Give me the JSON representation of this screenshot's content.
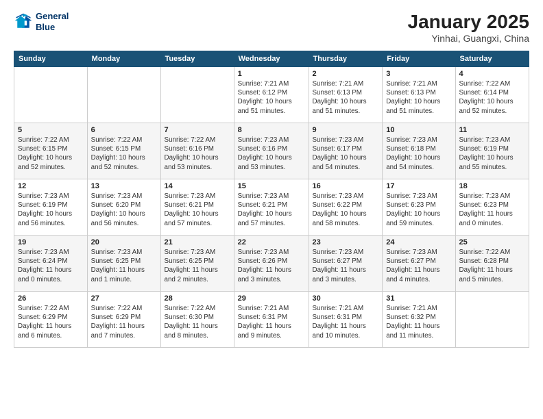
{
  "logo": {
    "line1": "General",
    "line2": "Blue"
  },
  "title": "January 2025",
  "subtitle": "Yinhai, Guangxi, China",
  "days_of_week": [
    "Sunday",
    "Monday",
    "Tuesday",
    "Wednesday",
    "Thursday",
    "Friday",
    "Saturday"
  ],
  "weeks": [
    [
      {
        "day": "",
        "info": ""
      },
      {
        "day": "",
        "info": ""
      },
      {
        "day": "",
        "info": ""
      },
      {
        "day": "1",
        "info": "Sunrise: 7:21 AM\nSunset: 6:12 PM\nDaylight: 10 hours\nand 51 minutes."
      },
      {
        "day": "2",
        "info": "Sunrise: 7:21 AM\nSunset: 6:13 PM\nDaylight: 10 hours\nand 51 minutes."
      },
      {
        "day": "3",
        "info": "Sunrise: 7:21 AM\nSunset: 6:13 PM\nDaylight: 10 hours\nand 51 minutes."
      },
      {
        "day": "4",
        "info": "Sunrise: 7:22 AM\nSunset: 6:14 PM\nDaylight: 10 hours\nand 52 minutes."
      }
    ],
    [
      {
        "day": "5",
        "info": "Sunrise: 7:22 AM\nSunset: 6:15 PM\nDaylight: 10 hours\nand 52 minutes."
      },
      {
        "day": "6",
        "info": "Sunrise: 7:22 AM\nSunset: 6:15 PM\nDaylight: 10 hours\nand 52 minutes."
      },
      {
        "day": "7",
        "info": "Sunrise: 7:22 AM\nSunset: 6:16 PM\nDaylight: 10 hours\nand 53 minutes."
      },
      {
        "day": "8",
        "info": "Sunrise: 7:23 AM\nSunset: 6:16 PM\nDaylight: 10 hours\nand 53 minutes."
      },
      {
        "day": "9",
        "info": "Sunrise: 7:23 AM\nSunset: 6:17 PM\nDaylight: 10 hours\nand 54 minutes."
      },
      {
        "day": "10",
        "info": "Sunrise: 7:23 AM\nSunset: 6:18 PM\nDaylight: 10 hours\nand 54 minutes."
      },
      {
        "day": "11",
        "info": "Sunrise: 7:23 AM\nSunset: 6:19 PM\nDaylight: 10 hours\nand 55 minutes."
      }
    ],
    [
      {
        "day": "12",
        "info": "Sunrise: 7:23 AM\nSunset: 6:19 PM\nDaylight: 10 hours\nand 56 minutes."
      },
      {
        "day": "13",
        "info": "Sunrise: 7:23 AM\nSunset: 6:20 PM\nDaylight: 10 hours\nand 56 minutes."
      },
      {
        "day": "14",
        "info": "Sunrise: 7:23 AM\nSunset: 6:21 PM\nDaylight: 10 hours\nand 57 minutes."
      },
      {
        "day": "15",
        "info": "Sunrise: 7:23 AM\nSunset: 6:21 PM\nDaylight: 10 hours\nand 57 minutes."
      },
      {
        "day": "16",
        "info": "Sunrise: 7:23 AM\nSunset: 6:22 PM\nDaylight: 10 hours\nand 58 minutes."
      },
      {
        "day": "17",
        "info": "Sunrise: 7:23 AM\nSunset: 6:23 PM\nDaylight: 10 hours\nand 59 minutes."
      },
      {
        "day": "18",
        "info": "Sunrise: 7:23 AM\nSunset: 6:23 PM\nDaylight: 11 hours\nand 0 minutes."
      }
    ],
    [
      {
        "day": "19",
        "info": "Sunrise: 7:23 AM\nSunset: 6:24 PM\nDaylight: 11 hours\nand 0 minutes."
      },
      {
        "day": "20",
        "info": "Sunrise: 7:23 AM\nSunset: 6:25 PM\nDaylight: 11 hours\nand 1 minute."
      },
      {
        "day": "21",
        "info": "Sunrise: 7:23 AM\nSunset: 6:25 PM\nDaylight: 11 hours\nand 2 minutes."
      },
      {
        "day": "22",
        "info": "Sunrise: 7:23 AM\nSunset: 6:26 PM\nDaylight: 11 hours\nand 3 minutes."
      },
      {
        "day": "23",
        "info": "Sunrise: 7:23 AM\nSunset: 6:27 PM\nDaylight: 11 hours\nand 3 minutes."
      },
      {
        "day": "24",
        "info": "Sunrise: 7:23 AM\nSunset: 6:27 PM\nDaylight: 11 hours\nand 4 minutes."
      },
      {
        "day": "25",
        "info": "Sunrise: 7:22 AM\nSunset: 6:28 PM\nDaylight: 11 hours\nand 5 minutes."
      }
    ],
    [
      {
        "day": "26",
        "info": "Sunrise: 7:22 AM\nSunset: 6:29 PM\nDaylight: 11 hours\nand 6 minutes."
      },
      {
        "day": "27",
        "info": "Sunrise: 7:22 AM\nSunset: 6:29 PM\nDaylight: 11 hours\nand 7 minutes."
      },
      {
        "day": "28",
        "info": "Sunrise: 7:22 AM\nSunset: 6:30 PM\nDaylight: 11 hours\nand 8 minutes."
      },
      {
        "day": "29",
        "info": "Sunrise: 7:21 AM\nSunset: 6:31 PM\nDaylight: 11 hours\nand 9 minutes."
      },
      {
        "day": "30",
        "info": "Sunrise: 7:21 AM\nSunset: 6:31 PM\nDaylight: 11 hours\nand 10 minutes."
      },
      {
        "day": "31",
        "info": "Sunrise: 7:21 AM\nSunset: 6:32 PM\nDaylight: 11 hours\nand 11 minutes."
      },
      {
        "day": "",
        "info": ""
      }
    ]
  ]
}
